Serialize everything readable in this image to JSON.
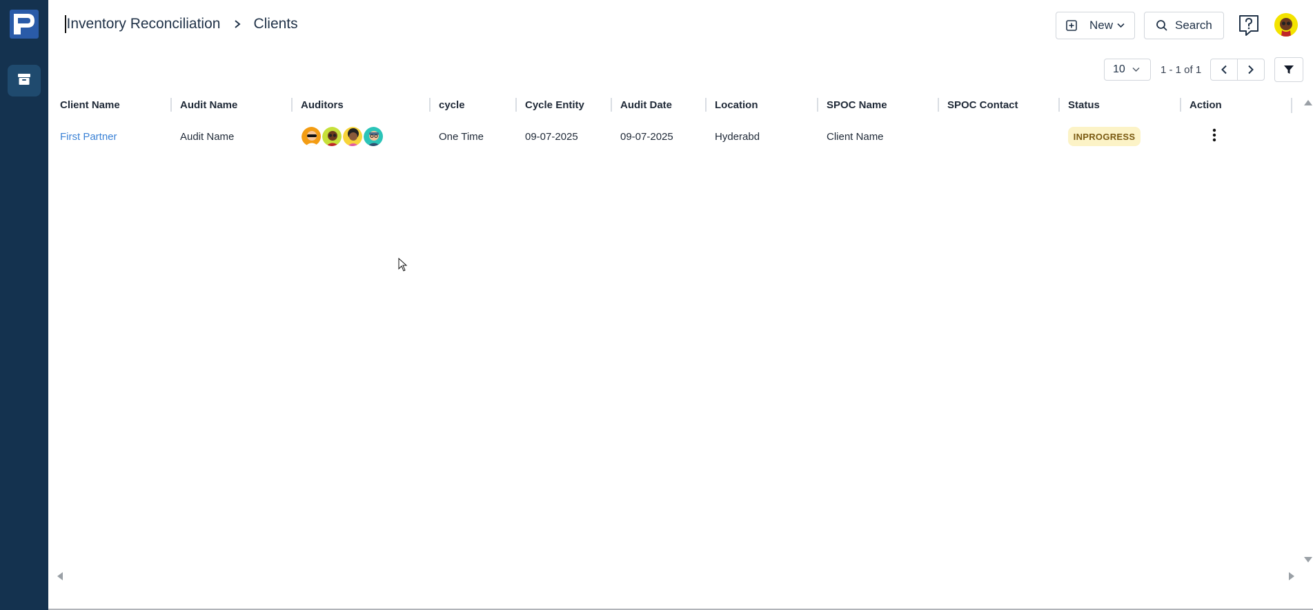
{
  "colors": {
    "sidebar": "#14324f",
    "link": "#3b82d6",
    "status_bg": "#fcf3c7",
    "status_text": "#7a5a12"
  },
  "sidebar": {
    "logo_icon": "app-logo-icon",
    "items": [
      {
        "icon": "archive-icon"
      }
    ]
  },
  "breadcrumb": {
    "items": [
      "Inventory Reconciliation",
      "Clients"
    ]
  },
  "toolbar": {
    "new_label": "New",
    "search_label": "Search",
    "help_icon": "help-icon",
    "user_avatar": "user-avatar"
  },
  "pager": {
    "page_size": "10",
    "info": "1 - 1 of 1"
  },
  "table": {
    "columns": [
      "Client Name",
      "Audit Name",
      "Auditors",
      "cycle",
      "Cycle Entity",
      "Audit Date",
      "Location",
      "SPOC Name",
      "SPOC Contact",
      "Status",
      "Action"
    ],
    "rows": [
      {
        "client_name": "First Partner",
        "audit_name": "Audit Name",
        "auditors": [
          "auditor-avatar-1",
          "auditor-avatar-2",
          "auditor-avatar-3",
          "auditor-avatar-4"
        ],
        "cycle": "One Time",
        "cycle_entity": "09-07-2025",
        "audit_date": "09-07-2025",
        "location": "Hyderabd",
        "spoc_name": "Client Name",
        "spoc_contact": "",
        "status": "INPROGRESS",
        "action_icon": "more-vertical-icon"
      }
    ]
  }
}
